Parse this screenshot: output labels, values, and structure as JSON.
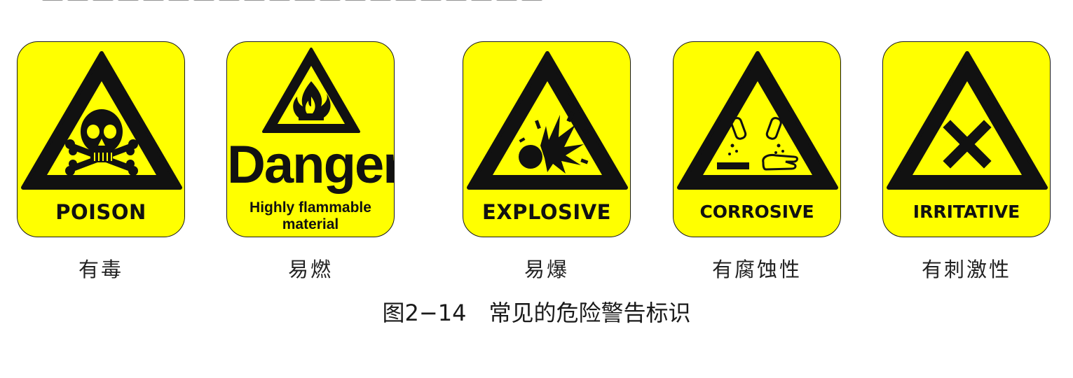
{
  "colors": {
    "sign_yellow": "#ffff00",
    "ink": "#111111",
    "page": "#ffffff"
  },
  "signs": [
    {
      "icon": "skull-crossbones-icon",
      "label": "POISON",
      "caption": "有毒"
    },
    {
      "icon": "flame-icon",
      "title": "Danger",
      "label_line1": "Highly flammable",
      "label_line2": "material",
      "caption": "易燃"
    },
    {
      "icon": "explosion-icon",
      "label": "EXPLOSIVE",
      "caption": "易爆"
    },
    {
      "icon": "corrosion-icon",
      "label": "CORROSIVE",
      "caption": "有腐蚀性"
    },
    {
      "icon": "cross-x-icon",
      "label": "IRRITATIVE",
      "caption": "有刺激性"
    }
  ],
  "figure_caption": "图2−14　常见的危险警告标识"
}
